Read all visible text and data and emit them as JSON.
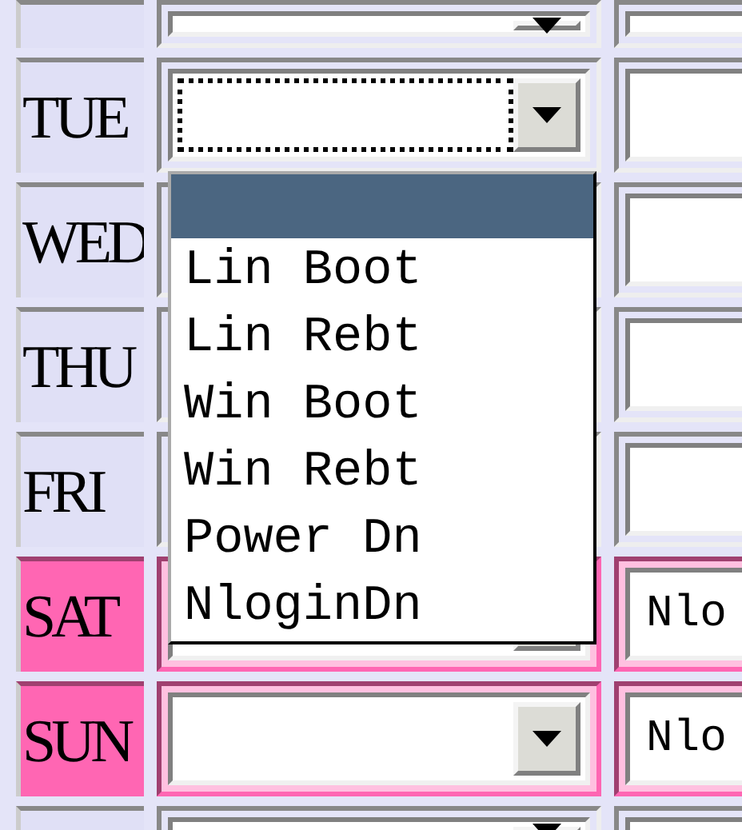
{
  "rows": [
    {
      "day": null,
      "weekend": false,
      "expanded": false,
      "focused": false
    },
    {
      "day": "TUE",
      "weekend": false,
      "expanded": true,
      "focused": true
    },
    {
      "day": "WED",
      "weekend": false,
      "expanded": false
    },
    {
      "day": "THU",
      "weekend": false,
      "expanded": false
    },
    {
      "day": "FRI",
      "weekend": false,
      "expanded": false
    },
    {
      "day": "SAT",
      "weekend": true,
      "expanded": false,
      "focused": false,
      "column_3": "Nlo"
    },
    {
      "day": "SUN",
      "weekend": true,
      "expanded": false,
      "focused": false,
      "column_3": "Nlo"
    },
    {
      "day": null,
      "weekend": false,
      "expanded": false,
      "focused": false
    }
  ],
  "dropdown_options": [
    {
      "selected": true
    },
    {
      "label": "Lin Boot",
      "selected": false
    },
    {
      "label": "Lin Rebt",
      "selected": false
    },
    {
      "label": "Win Boot",
      "selected": false
    },
    {
      "label": "Win Rebt",
      "selected": false
    },
    {
      "label": "Power Dn",
      "selected": false
    },
    {
      "label": "NloginDn",
      "selected": false
    }
  ]
}
